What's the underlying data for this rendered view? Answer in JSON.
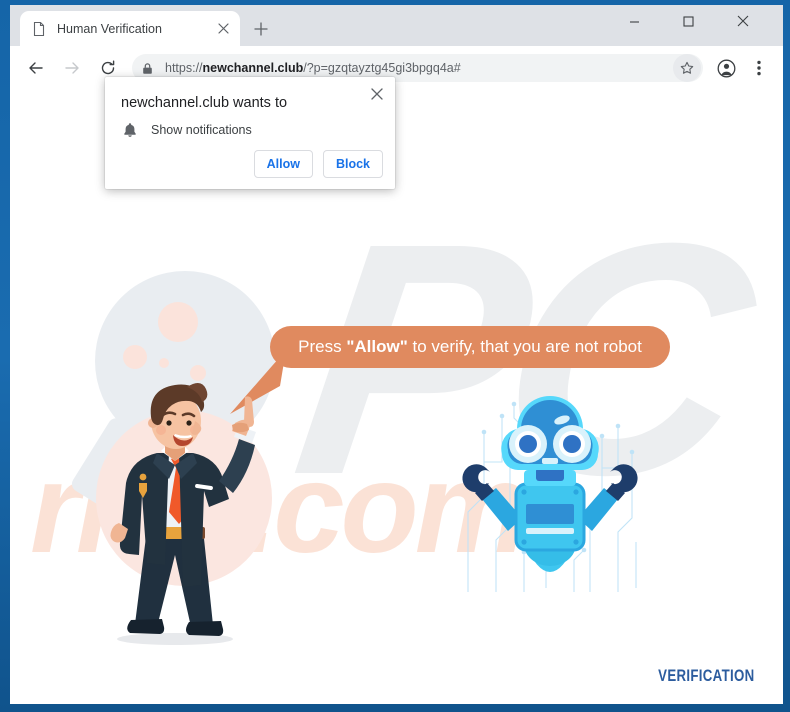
{
  "window": {
    "controls": {
      "minimize": "minimize",
      "maximize": "maximize",
      "close": "close"
    },
    "frame_color": "#1565a8"
  },
  "tabstrip": {
    "tab": {
      "title": "Human Verification",
      "favicon": "page-icon",
      "close": "×"
    },
    "new_tab_label": "+"
  },
  "toolbar": {
    "back": "←",
    "forward": "→",
    "reload": "⟳",
    "lock_icon": "lock-icon",
    "url_scheme": "https://",
    "url_domain": "newchannel.club",
    "url_path": "/?p=gzqtayztg45gi3bpgq4a#",
    "url_full": "https://newchannel.club/?p=gzqtayztg45gi3bpgq4a#",
    "bookmark_icon": "star-icon",
    "profile_icon": "profile-icon",
    "menu_icon": "three-dot-menu-icon"
  },
  "permission_popup": {
    "title": "newchannel.club wants to",
    "permission_icon": "bell-icon",
    "permission_label": "Show notifications",
    "allow_label": "Allow",
    "block_label": "Block",
    "close_label": "×",
    "accent_color": "#1a73e8"
  },
  "page": {
    "bubble": {
      "prefix": "Press ",
      "emphasis": "\"Allow\"",
      "suffix": " to verify, that you are not robot",
      "bg_color": "#e08a5f"
    },
    "watermark_brand": "PC",
    "watermark_site": "risk.com",
    "footer_label": "VERIFICATION",
    "footer_color": "#2c5c9e",
    "illustration_man": "pointing-businessman-illustration",
    "illustration_robot": "blue-robot-illustration",
    "decor_magnifier": "magnifying-glass-shape"
  }
}
